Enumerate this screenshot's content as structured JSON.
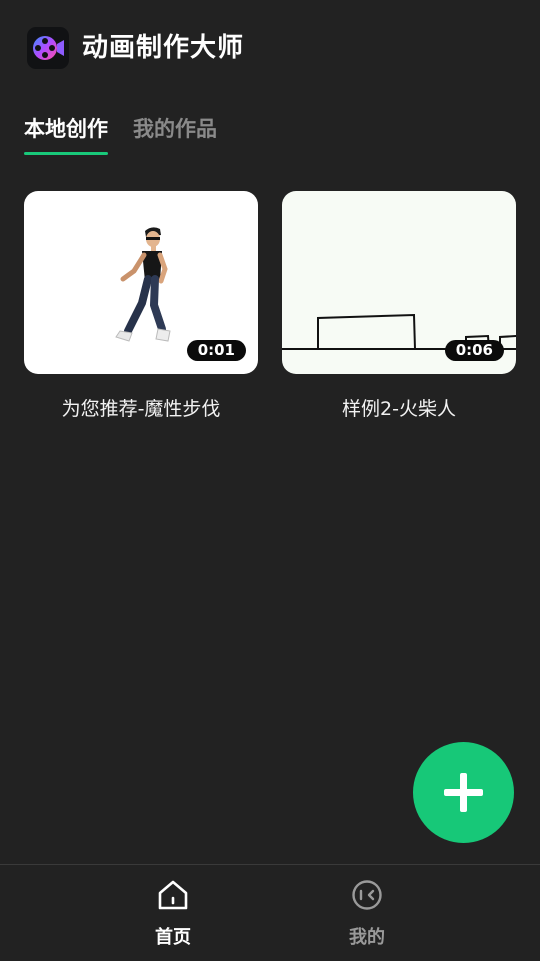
{
  "app": {
    "title": "动画制作大师",
    "logo_icon": "film-reel-camera-icon"
  },
  "tabs": [
    {
      "label": "本地创作",
      "active": true
    },
    {
      "label": "我的作品",
      "active": false
    }
  ],
  "cards": [
    {
      "title": "为您推荐-魔性步伐",
      "duration": "0:01",
      "thumbnail": "walking-man-animation"
    },
    {
      "title": "样例2-火柴人",
      "duration": "0:06",
      "thumbnail": "stick-figure-line-drawing"
    }
  ],
  "fab": {
    "icon": "plus-icon"
  },
  "bottom_nav": [
    {
      "label": "首页",
      "icon": "home-icon",
      "active": true
    },
    {
      "label": "我的",
      "icon": "profile-face-icon",
      "active": false
    }
  ],
  "colors": {
    "background": "#222222",
    "accent": "#17c878",
    "inactive_text": "#8a8a8a"
  }
}
